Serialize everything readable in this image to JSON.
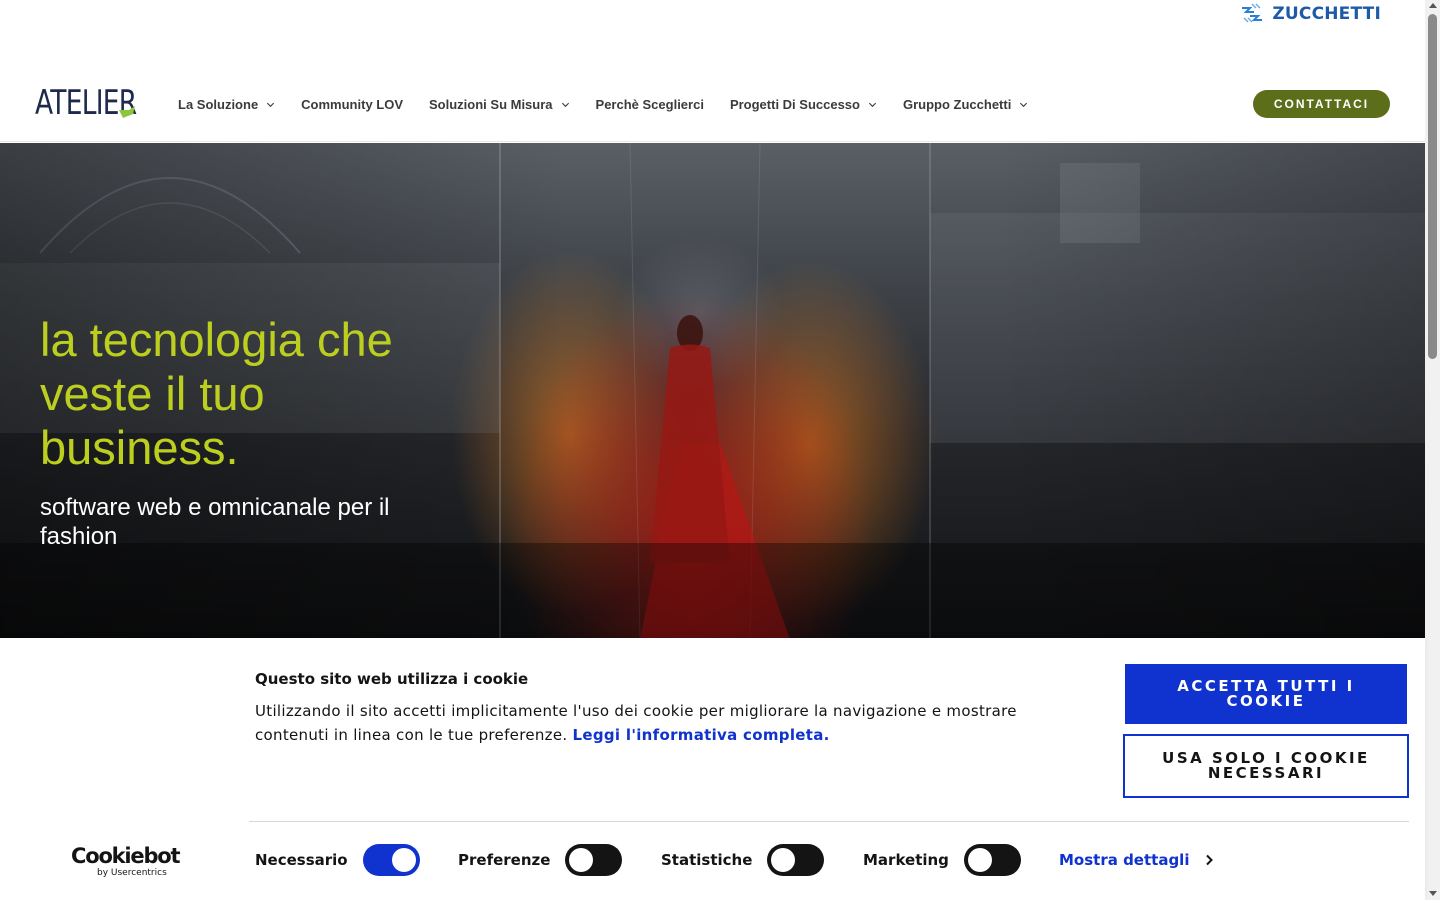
{
  "brand": {
    "group_logo_text": "ZUCCHETTI",
    "site_logo_text": "ATELIER"
  },
  "nav": {
    "items": [
      {
        "label": "La Soluzione",
        "has_dropdown": true
      },
      {
        "label": "Community LOV",
        "has_dropdown": false
      },
      {
        "label": "Soluzioni Su Misura",
        "has_dropdown": true
      },
      {
        "label": "Perchè Sceglierci",
        "has_dropdown": false
      },
      {
        "label": "Progetti Di Successo",
        "has_dropdown": true
      },
      {
        "label": "Gruppo Zucchetti",
        "has_dropdown": true
      }
    ],
    "cta_label": "CONTATTACI"
  },
  "hero": {
    "headline": "la tecnologia che veste il tuo business.",
    "subheadline": "software web e omnicanale per il fashion"
  },
  "cookie_banner": {
    "title": "Questo sito web utilizza i cookie",
    "text": "Utilizzando il sito accetti implicitamente l'uso dei cookie per migliorare la navigazione e mostrare contenuti in linea con le tue preferenze.",
    "link_label": "Leggi l'informativa completa.",
    "accept_all_label": "ACCETTA TUTTI I COOKIE",
    "necessary_only_label": "USA SOLO I COOKIE NECESSARI",
    "provider_name": "Cookiebot",
    "provider_by": "by Usercentrics",
    "consents": [
      {
        "label": "Necessario",
        "enabled": true
      },
      {
        "label": "Preferenze",
        "enabled": false
      },
      {
        "label": "Statistiche",
        "enabled": false
      },
      {
        "label": "Marketing",
        "enabled": false
      }
    ],
    "details_label": "Mostra dettagli"
  },
  "colors": {
    "accent_olive": "#5c6e1a",
    "headline_lime": "#bccf1f",
    "cookie_blue": "#1032cf",
    "logo_navy": "#1e2a4a",
    "zucchetti_blue": "#1e5aa8"
  }
}
